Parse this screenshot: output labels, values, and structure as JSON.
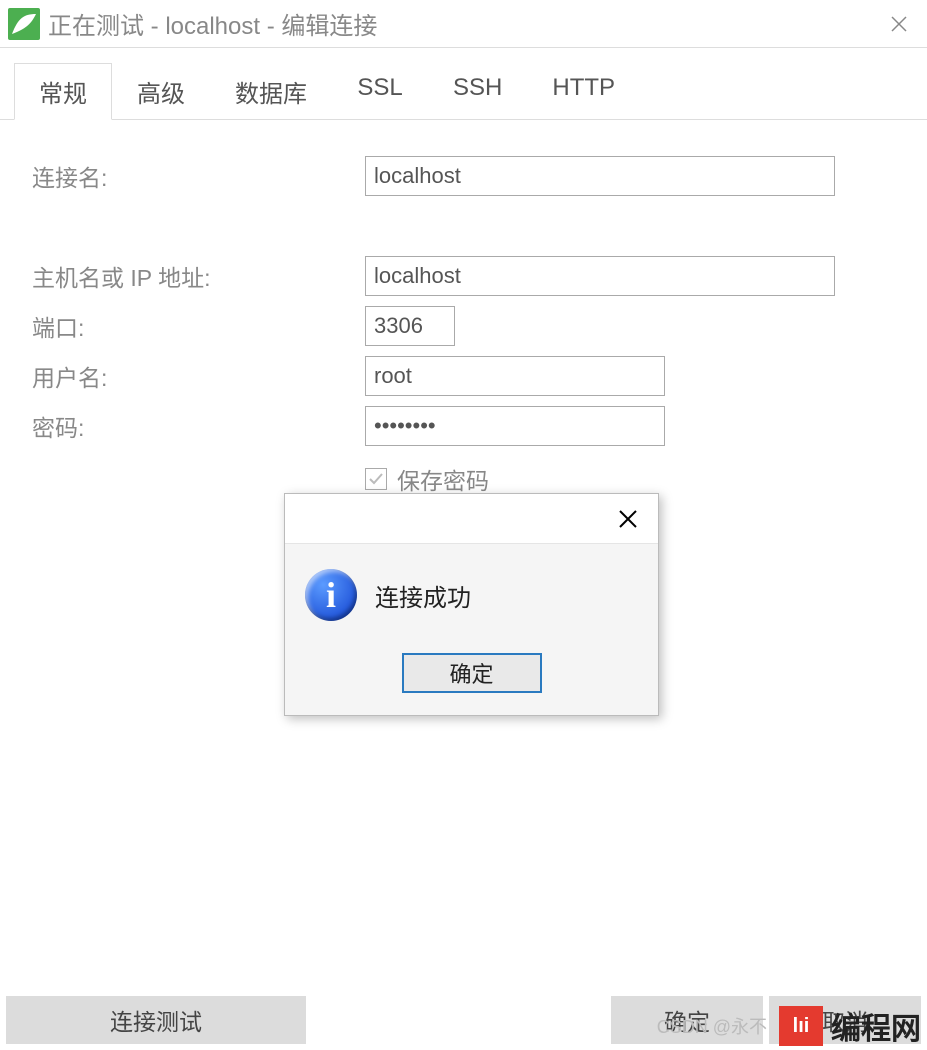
{
  "titlebar": {
    "title": "正在测试 - localhost - 编辑连接"
  },
  "tabs": [
    {
      "label": "常规"
    },
    {
      "label": "高级"
    },
    {
      "label": "数据库"
    },
    {
      "label": "SSL"
    },
    {
      "label": "SSH"
    },
    {
      "label": "HTTP"
    }
  ],
  "form": {
    "connection_name_label": "连接名:",
    "connection_name_value": "localhost",
    "host_label": "主机名或 IP 地址:",
    "host_value": "localhost",
    "port_label": "端口:",
    "port_value": "3306",
    "user_label": "用户名:",
    "user_value": "root",
    "password_label": "密码:",
    "password_value": "••••••••",
    "save_password_label": "保存密码"
  },
  "buttons": {
    "test_connection": "连接测试",
    "ok": "确定",
    "cancel": "取消"
  },
  "modal": {
    "message": "连接成功",
    "ok": "确定"
  },
  "watermark": {
    "csdn": "CSDN @永不",
    "logo": "lıi",
    "text": "编程网"
  }
}
